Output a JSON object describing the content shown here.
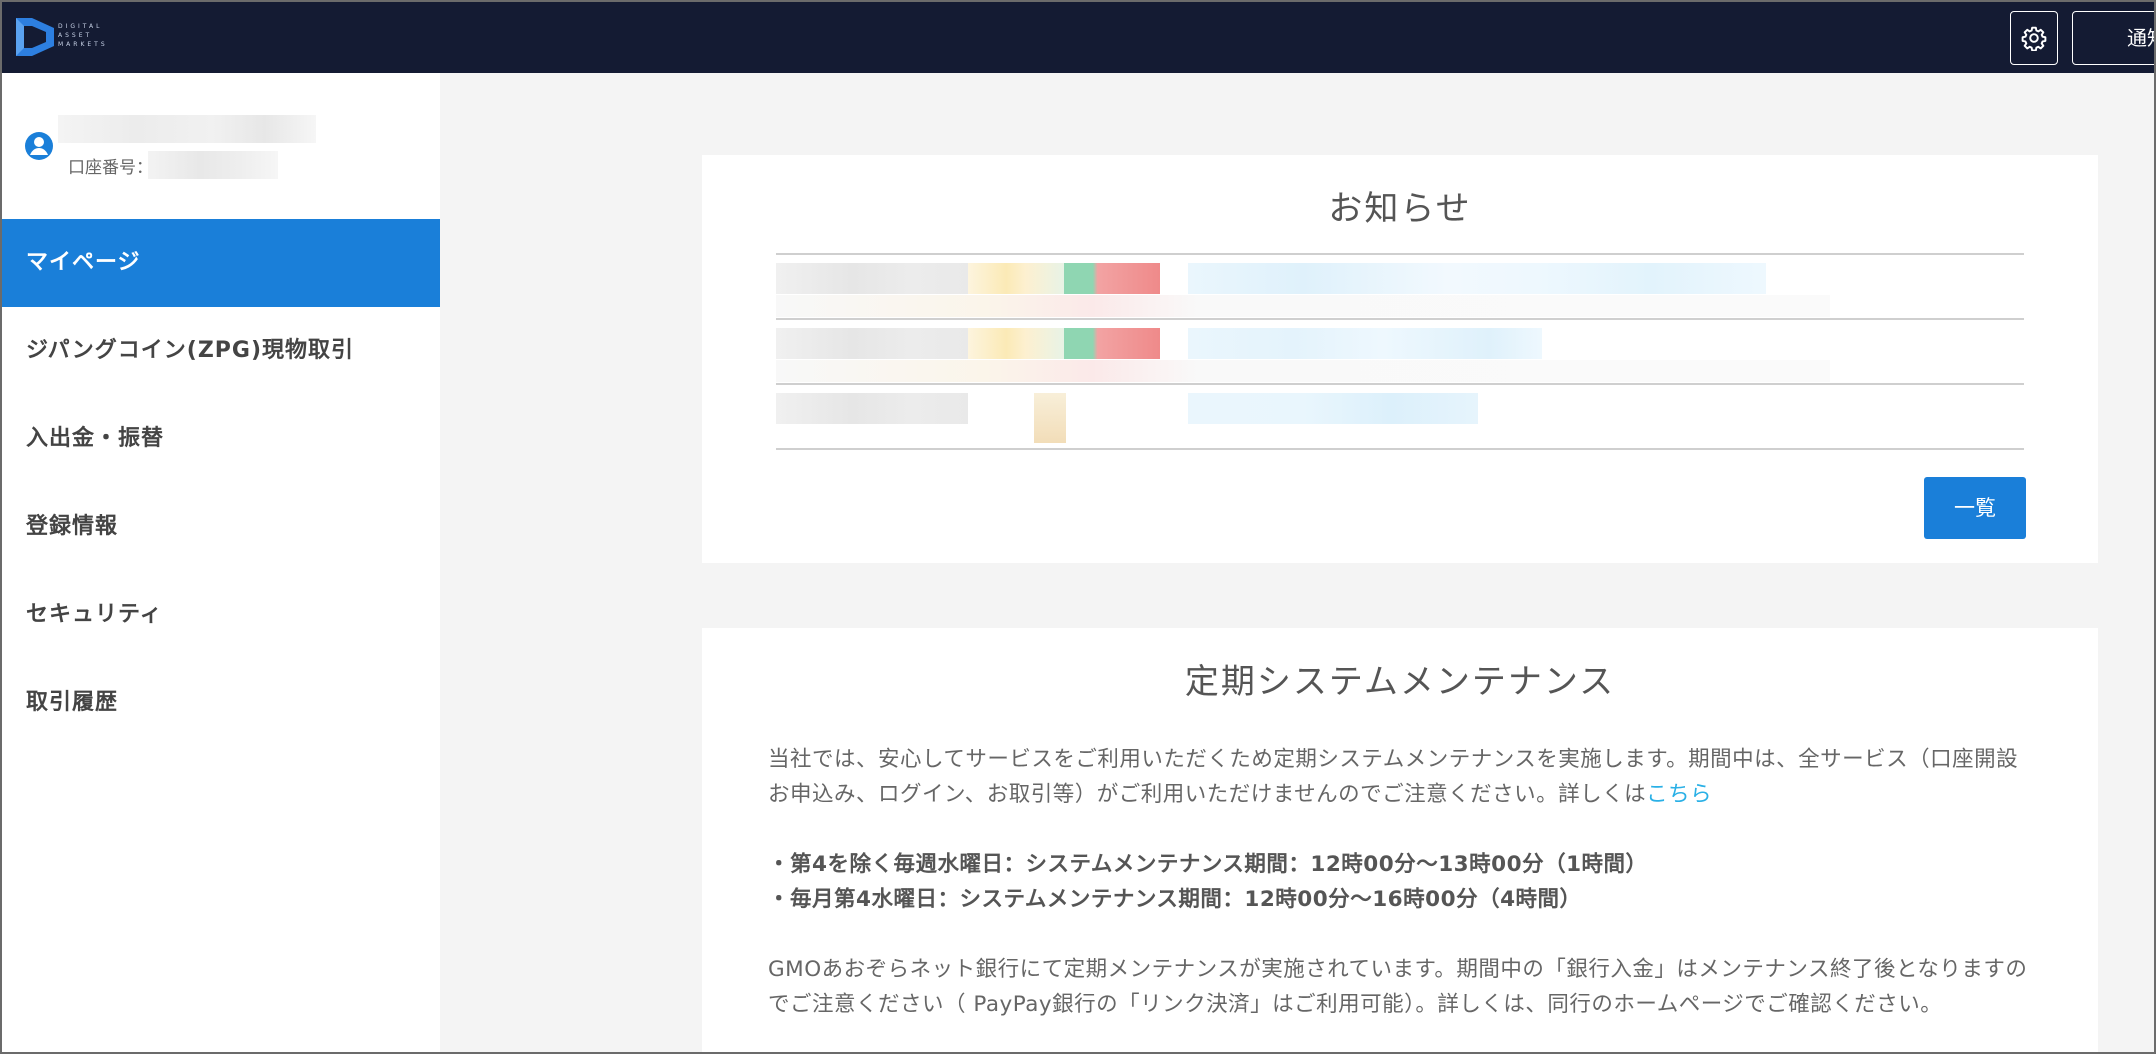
{
  "header": {
    "logo_lines": [
      "DIGITAL",
      "ASSET",
      "MARKETS"
    ],
    "notify_label": "通知",
    "settings_icon": "gear-icon"
  },
  "sidebar": {
    "account_label": "口座番号：",
    "user_icon": "user-circle-icon",
    "items": [
      {
        "label": "マイページ",
        "active": true
      },
      {
        "label": "ジパングコイン(ZPG)現物取引",
        "active": false
      },
      {
        "label": "入出金・振替",
        "active": false
      },
      {
        "label": "登録情報",
        "active": false
      },
      {
        "label": "セキュリティ",
        "active": false
      },
      {
        "label": "取引履歴",
        "active": false
      }
    ]
  },
  "news": {
    "title": "お知らせ",
    "list_button": "一覧"
  },
  "maintenance": {
    "title": "定期システムメンテナンス",
    "intro": "当社では、安心してサービスをご利用いただくため定期システムメンテナンスを実施します。期間中は、全サービス（口座開設お申込み、ログイン、お取引等）がご利用いただけませんのでご注意ください。詳しくは",
    "intro_link": "こちら",
    "line1": "・第4を除く毎週水曜日：システムメンテナンス期間：12時00分～13時00分（1時間）",
    "line2": "・毎月第4水曜日：システムメンテナンス期間：12時00分～16時00分（4時間）",
    "bank_note": "GMOあおぞらネット銀行にて定期メンテナンスが実施されています。期間中の「銀行入金」はメンテナンス終了後となりますのでご注意ください（ PayPay銀行の「リンク決済」はご利用可能）。詳しくは、同行のホームページでご確認ください。"
  },
  "colors": {
    "topbar": "#141b33",
    "accent": "#1a7fd9",
    "link": "#2ab0e6"
  }
}
